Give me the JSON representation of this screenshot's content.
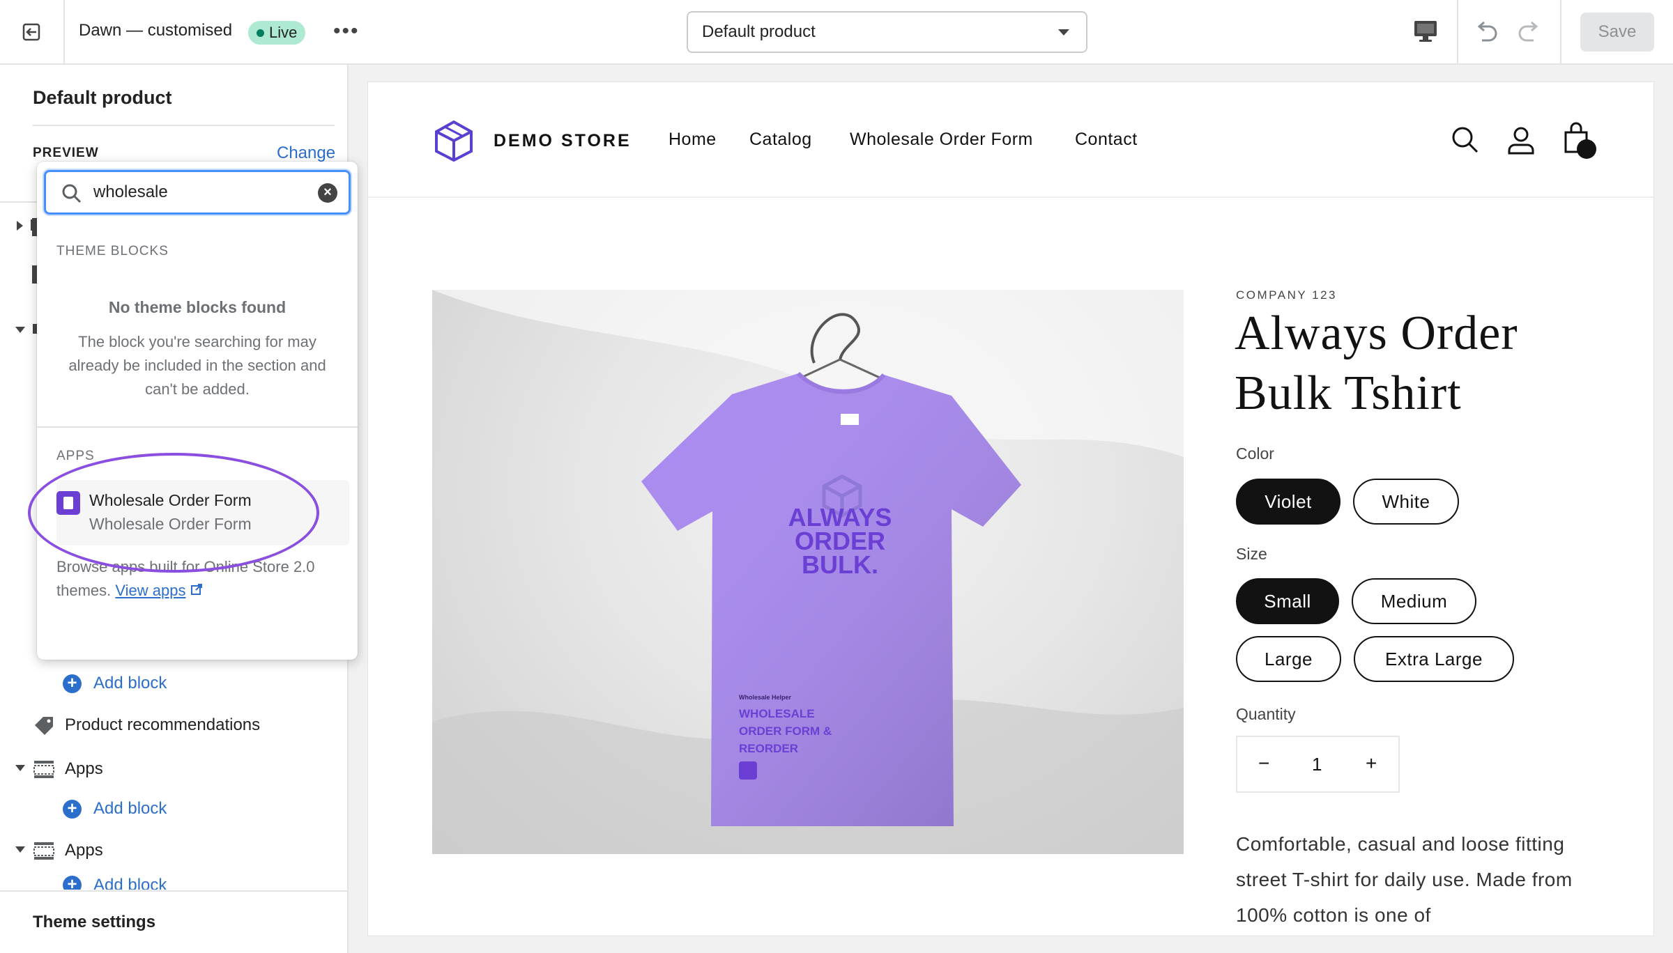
{
  "topbar": {
    "theme_name": "Dawn — customised",
    "live_badge": "Live",
    "more_label": "•••",
    "template": "Default product",
    "save_label": "Save"
  },
  "sidebar": {
    "title": "Default product",
    "preview_label": "PREVIEW",
    "change_label": "Change",
    "sections": [
      {
        "label": "Product recommendations",
        "icon": "tag-icon"
      },
      {
        "label": "Apps",
        "icon": "section-icon"
      },
      {
        "label": "Apps",
        "icon": "section-icon"
      }
    ],
    "add_block": "Add block",
    "theme_settings": "Theme settings"
  },
  "popover": {
    "search_value": "wholesale",
    "theme_blocks_heading": "THEME BLOCKS",
    "empty_title": "No theme blocks found",
    "empty_desc": "The block you're searching for may already be included in the section and can't be added.",
    "apps_heading": "APPS",
    "app_name": "Wholesale Order Form",
    "app_sub": "Wholesale Order Form",
    "browse_text": "Browse apps built for Online Store 2.0 themes.",
    "view_apps": "View apps"
  },
  "store": {
    "name": "DEMO STORE",
    "nav": [
      "Home",
      "Catalog",
      "Wholesale Order Form",
      "Contact"
    ],
    "product_image": {
      "print_big": [
        "ALWAYS",
        "ORDER",
        "BULK."
      ],
      "print_small_brand": "Wholesale Helper",
      "print_small_title": [
        "WHOLESALE",
        "ORDER FORM &",
        "REORDER"
      ]
    },
    "vendor": "COMPANY 123",
    "title": "Always Order Bulk Tshirt",
    "color_label": "Color",
    "colors": [
      "Violet",
      "White"
    ],
    "size_label": "Size",
    "sizes": [
      "Small",
      "Medium",
      "Large",
      "Extra Large"
    ],
    "quantity_label": "Quantity",
    "quantity": "1",
    "description": "Comfortable, casual and loose fitting street T-shirt for daily use. Made from 100% cotton is one of"
  },
  "colors": {
    "accent": "#2c6ecb",
    "live": "#aee9d1",
    "shirt": "#a98af0",
    "shirt_print": "#6b3fd4",
    "highlight_ring": "#8a4fe0"
  }
}
